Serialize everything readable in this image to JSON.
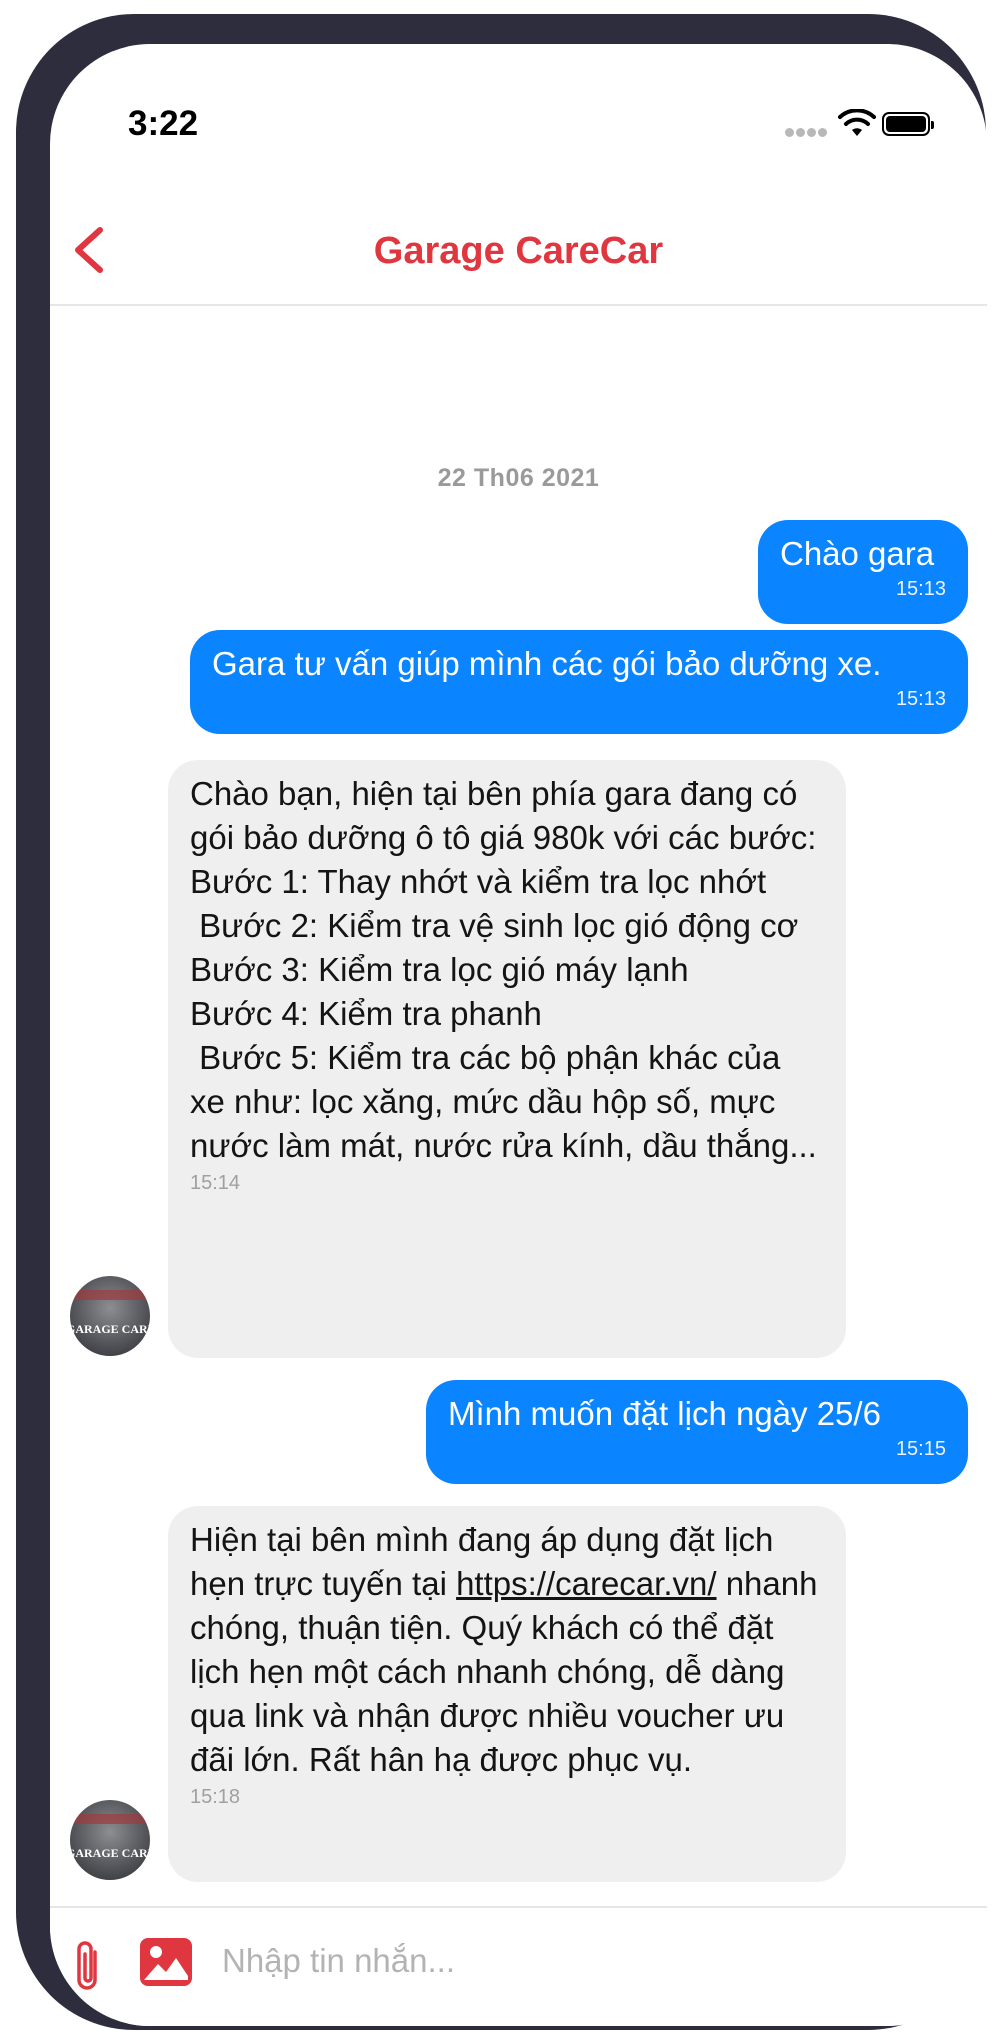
{
  "status_bar": {
    "time": "3:22"
  },
  "header": {
    "title": "Garage CareCar"
  },
  "date_separator": "22 Th06 2021",
  "avatar_brand": "GARAGE CARECAR",
  "messages": [
    {
      "direction": "out",
      "text": "Chào gara",
      "time": "15:13"
    },
    {
      "direction": "out",
      "text": "Gara tư vấn giúp mình các gói bảo dưỡng xe.",
      "time": "15:13"
    },
    {
      "direction": "in",
      "text": "Chào bạn, hiện tại bên phía gara đang có gói bảo dưỡng ô tô giá 980k với các bước:\nBước 1: Thay nhớt và kiểm tra lọc nhớt\n Bước 2: Kiểm tra vệ sinh lọc gió động cơ\nBước 3: Kiểm tra lọc gió máy lạnh\nBước 4: Kiểm tra phanh\n Bước 5: Kiểm tra các bộ phận khác của xe như: lọc xăng, mức dầu hộp số, mực nước làm mát, nước rửa kính, dầu thắng...",
      "time": "15:14"
    },
    {
      "direction": "out",
      "text": "Mình muốn đặt lịch ngày 25/6",
      "time": "15:15"
    },
    {
      "direction": "in",
      "text_before": "Hiện tại bên mình đang áp dụng đặt lịch hẹn trực tuyến tại ",
      "link": "https://carecar.vn/",
      "text_after": " nhanh chóng, thuận tiện. Quý khách có thể đặt lịch hẹn một cách nhanh chóng, dễ dàng qua link và nhận được nhiều voucher ưu đãi lớn. Rất hân hạ được phục vụ.",
      "time": "15:18"
    }
  ],
  "composer": {
    "placeholder": "Nhập tin nhắn..."
  },
  "colors": {
    "accent": "#e0363f",
    "outgoing": "#0a84ff",
    "incoming": "#efefef"
  }
}
